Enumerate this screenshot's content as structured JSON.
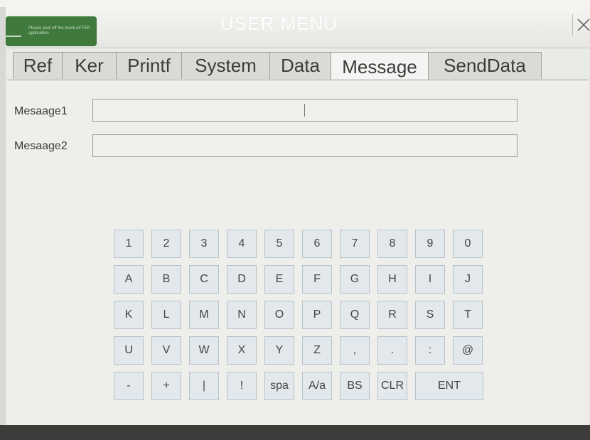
{
  "window": {
    "title": "USER MENU",
    "sticker_text": "Please peel off the mask AFTER application"
  },
  "tabs": [
    "Ref",
    "Ker",
    "Printf",
    "System",
    "Data",
    "Message",
    "SendData"
  ],
  "active_tab": "Message",
  "fields": [
    {
      "label": "Mesaage1",
      "value": ""
    },
    {
      "label": "Mesaage2",
      "value": ""
    }
  ],
  "keyboard": {
    "rows": [
      [
        "1",
        "2",
        "3",
        "4",
        "5",
        "6",
        "7",
        "8",
        "9",
        "0"
      ],
      [
        "A",
        "B",
        "C",
        "D",
        "E",
        "F",
        "G",
        "H",
        "I",
        "J"
      ],
      [
        "K",
        "L",
        "M",
        "N",
        "O",
        "P",
        "Q",
        "R",
        "S",
        "T"
      ],
      [
        "U",
        "V",
        "W",
        "X",
        "Y",
        "Z",
        ",",
        ".",
        ":",
        "@"
      ],
      [
        "-",
        "+",
        "|",
        "!",
        "spa",
        "A/a",
        "BS",
        "CLR",
        "ENT"
      ]
    ]
  }
}
